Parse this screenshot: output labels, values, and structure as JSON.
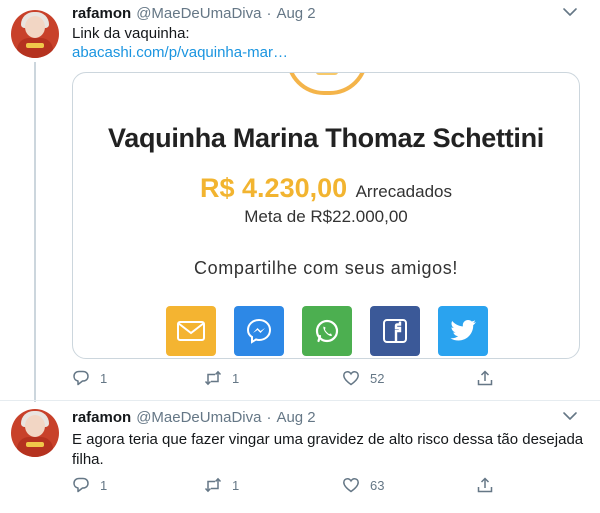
{
  "tweets": [
    {
      "author_name": "rafamon",
      "handle": "@MaeDeUmaDiva",
      "separator": "·",
      "date": "Aug 2",
      "text": "Link da vaquinha:",
      "link": "abacashi.com/p/vaquinha-mar…",
      "card": {
        "title": "Vaquinha Marina Thomaz Schettini",
        "amount": "R$ 4.230,00",
        "amount_label": "Arrecadados",
        "goal": "Meta de R$22.000,00",
        "share_label": "Compartilhe com seus amigos!",
        "share_buttons": [
          {
            "icon": "email-icon",
            "color": "#f4b431"
          },
          {
            "icon": "messenger-icon",
            "color": "#2d88e6"
          },
          {
            "icon": "whatsapp-icon",
            "color": "#4caf50"
          },
          {
            "icon": "facebook-icon",
            "color": "#3b5998"
          },
          {
            "icon": "twitter-icon",
            "color": "#2aa3ef"
          }
        ]
      },
      "replies": "1",
      "retweets": "1",
      "likes": "52"
    },
    {
      "author_name": "rafamon",
      "handle": "@MaeDeUmaDiva",
      "separator": "·",
      "date": "Aug 2",
      "text": "E agora teria que fazer vingar uma gravidez de alto risco dessa tão desejada filha.",
      "replies": "1",
      "retweets": "1",
      "likes": "63"
    }
  ],
  "colors": {
    "link": "#1b95e0",
    "muted": "#657786",
    "amount": "#f2b430"
  }
}
